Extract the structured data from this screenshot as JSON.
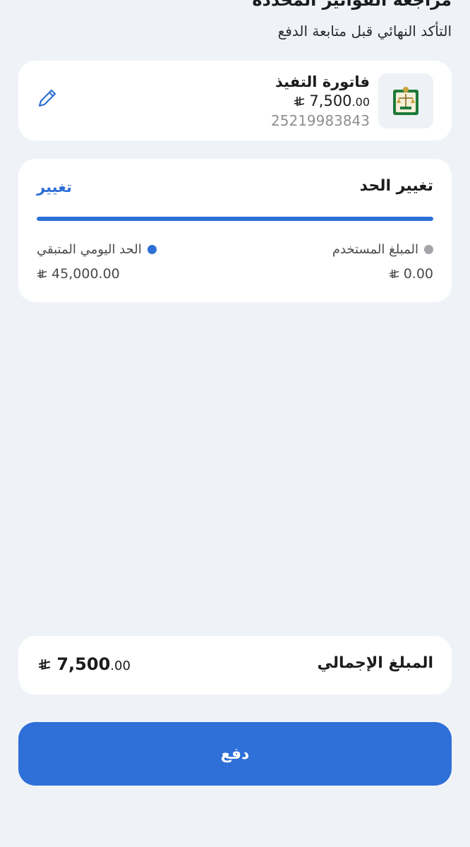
{
  "header": {
    "title": "مراجعة الفواتير المحددة",
    "subtitle": "التأكد النهائي قبل متابعة الدفع"
  },
  "bill": {
    "name": "فاتورة التفيذ",
    "amount_int": "7,500",
    "amount_dec": ".00",
    "number": "25219983843",
    "logo_icon": "ministry-of-justice-logo",
    "edit_icon": "pencil-icon"
  },
  "limit": {
    "title": "تغيير الحد",
    "change_label": "تغيير",
    "used_label": "المبلغ المستخدم",
    "used_value": "0.00",
    "remaining_label": "الحد اليومي المتبقي",
    "remaining_value": "45,000.00",
    "remaining_fraction": 1.0
  },
  "total": {
    "label": "المبلغ الإجمالي",
    "amount_int": "7,500",
    "amount_dec": ".00"
  },
  "pay_button": {
    "label": "دفع"
  },
  "colors": {
    "accent": "#2e6fd8",
    "background": "#eff3f8",
    "card": "#ffffff"
  }
}
